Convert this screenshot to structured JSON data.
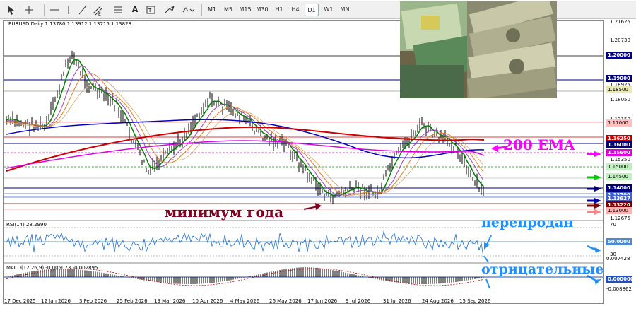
{
  "toolbar": {
    "timeframes": [
      "M1",
      "M5",
      "M15",
      "M30",
      "H1",
      "H4",
      "D1",
      "W1",
      "MN"
    ],
    "active": "D1"
  },
  "symbol_info": "EURUSD,Daily  1.13780 1.13912 1.13715 1.13828",
  "rsi_label": "RSI(14) 28.2990",
  "macd_label": "MACD(12,26,9) -0.005073 -0.002895",
  "price_ticks": [
    "1.21625",
    "1.20730",
    "1.18925",
    "1.18050",
    "1.17150",
    "1.15350",
    "1.12675"
  ],
  "rsi_ticks": [
    "70",
    "30"
  ],
  "macd_ticks": [
    "0.007428",
    "0.00000",
    "-0.008862"
  ],
  "level_labels": [
    {
      "text": "1.20000",
      "bg": "#000080"
    },
    {
      "text": "1.19000",
      "bg": ""
    },
    {
      "text": "1.18500",
      "bg": ""
    },
    {
      "text": "1.17000",
      "bg": ""
    },
    {
      "text": "1.16250",
      "bg": "#c00000"
    },
    {
      "text": "1.16000",
      "bg": "#000080"
    },
    {
      "text": "1.15600",
      "bg": "#e000e0"
    },
    {
      "text": "1.15000",
      "bg": ""
    },
    {
      "text": "1.14500",
      "bg": ""
    },
    {
      "text": "1.14000",
      "bg": "#000080"
    },
    {
      "text": "1.13700",
      "bg": "#4060d0"
    },
    {
      "text": "1.13627",
      "bg": "#4060d0"
    },
    {
      "text": "1.13220",
      "bg": "#800000"
    },
    {
      "text": "1.13000",
      "bg": ""
    }
  ],
  "rsi_level_label": "50.0000",
  "macd_zero_label": "0.000000",
  "dates": [
    "17 Dec 2025",
    "12 Jan 2026",
    "3 Feb 2026",
    "25 Feb 2026",
    "19 Mar 2026",
    "10 Apr 2026",
    "4 May 2026",
    "26 May 2026",
    "17 Jun 2026",
    "9 Jul 2026",
    "31 Jul 2026",
    "24 Aug 2026",
    "15 Sep 2026"
  ],
  "annotations": {
    "ema": "200 EMA",
    "year_low": "минимум года",
    "oversold": "перепродан",
    "negative": "отрицательные"
  },
  "colors": {
    "ema200": "#d00000",
    "ema_magenta": "#e000e0",
    "ema_blue": "#0000c0",
    "ma_green": "#008000",
    "ma_orange": "#e08020",
    "annotation_magenta": "#ff00ff",
    "annotation_brown": "#800020",
    "annotation_blue": "#1e90ff"
  }
}
